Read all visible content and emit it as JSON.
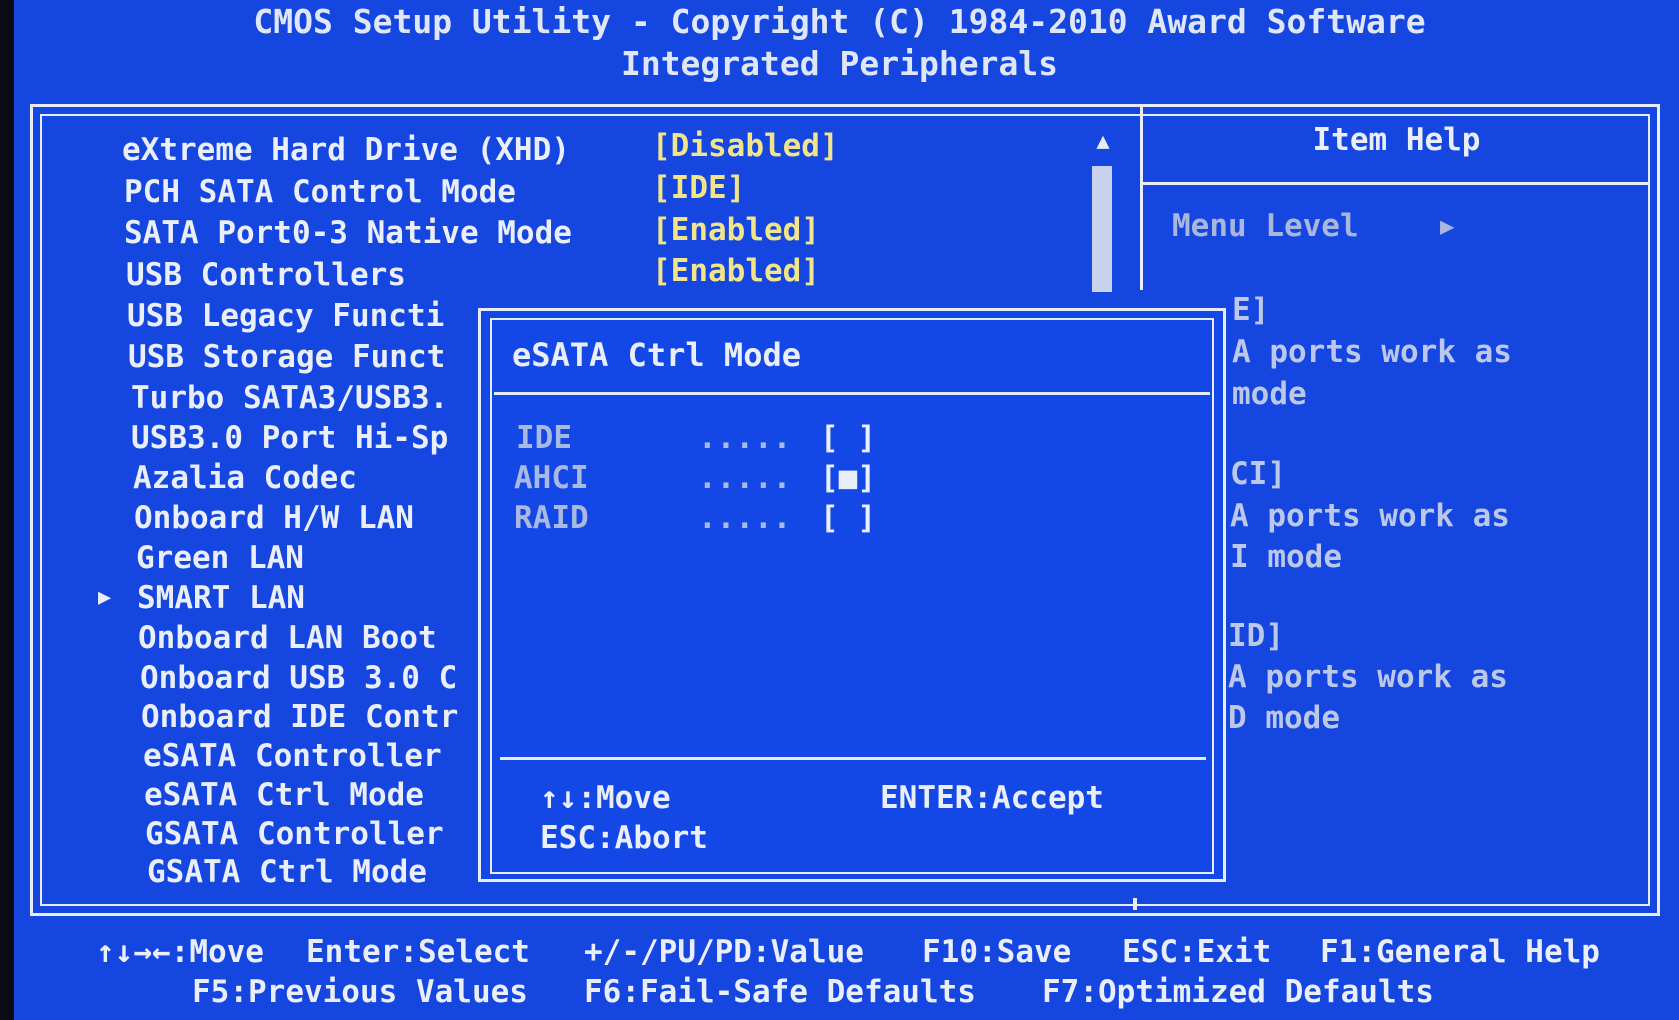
{
  "title": {
    "line1": "CMOS Setup Utility - Copyright (C) 1984-2010 Award Software",
    "line2": "Integrated Peripherals"
  },
  "menu": {
    "items": [
      {
        "label": "eXtreme Hard Drive (XHD)",
        "value": "[Disabled]"
      },
      {
        "label": "PCH SATA Control Mode",
        "value": "[IDE]"
      },
      {
        "label": "SATA Port0-3 Native Mode",
        "value": "[Enabled]"
      },
      {
        "label": "USB Controllers",
        "value": "[Enabled]"
      },
      {
        "label": "USB Legacy Functi"
      },
      {
        "label": "USB Storage Funct"
      },
      {
        "label": "Turbo SATA3/USB3."
      },
      {
        "label": "USB3.0 Port Hi-Sp"
      },
      {
        "label": "Azalia Codec"
      },
      {
        "label": "Onboard H/W LAN"
      },
      {
        "label": "Green LAN"
      },
      {
        "label": "SMART LAN",
        "submenu_marker": "▶"
      },
      {
        "label": "Onboard LAN Boot"
      },
      {
        "label": "Onboard USB 3.0 C"
      },
      {
        "label": "Onboard IDE Contr"
      },
      {
        "label": "eSATA Controller"
      },
      {
        "label": "eSATA Ctrl Mode"
      },
      {
        "label": "GSATA Controller"
      },
      {
        "label": "GSATA Ctrl Mode"
      }
    ]
  },
  "scrollbar": {
    "up_arrow": "▲"
  },
  "help": {
    "title": "Item Help",
    "menu_level": "Menu Level",
    "menu_level_arrow": "▶",
    "lines": [
      "E]",
      "A ports work as",
      " mode",
      "CI]",
      "A ports work as",
      "I mode",
      "ID]",
      "A ports work as",
      "D mode"
    ]
  },
  "popup": {
    "title": "eSATA Ctrl Mode",
    "options": [
      {
        "name": "IDE",
        "dots": ".....",
        "box": "[ ]",
        "selected": false
      },
      {
        "name": "AHCI",
        "dots": ".....",
        "box": "[■]",
        "selected": true
      },
      {
        "name": "RAID",
        "dots": ".....",
        "box": "[ ]",
        "selected": false
      }
    ],
    "keys": {
      "move": "↑↓:Move",
      "accept": "ENTER:Accept",
      "abort": "ESC:Abort"
    }
  },
  "footer": {
    "move": "↑↓→←:Move",
    "select": "Enter:Select",
    "value": "+/-/PU/PD:Value",
    "save": "F10:Save",
    "exit": "ESC:Exit",
    "general_help": "F1:General Help",
    "previous": "F5:Previous Values",
    "failsafe": "F6:Fail-Safe Defaults",
    "optimized": "F7:Optimized Defaults"
  },
  "colors": {
    "background": "#1646e0",
    "text": "#e9eef8",
    "value_text": "#f2e48a",
    "dim_text": "#aab9e4"
  }
}
